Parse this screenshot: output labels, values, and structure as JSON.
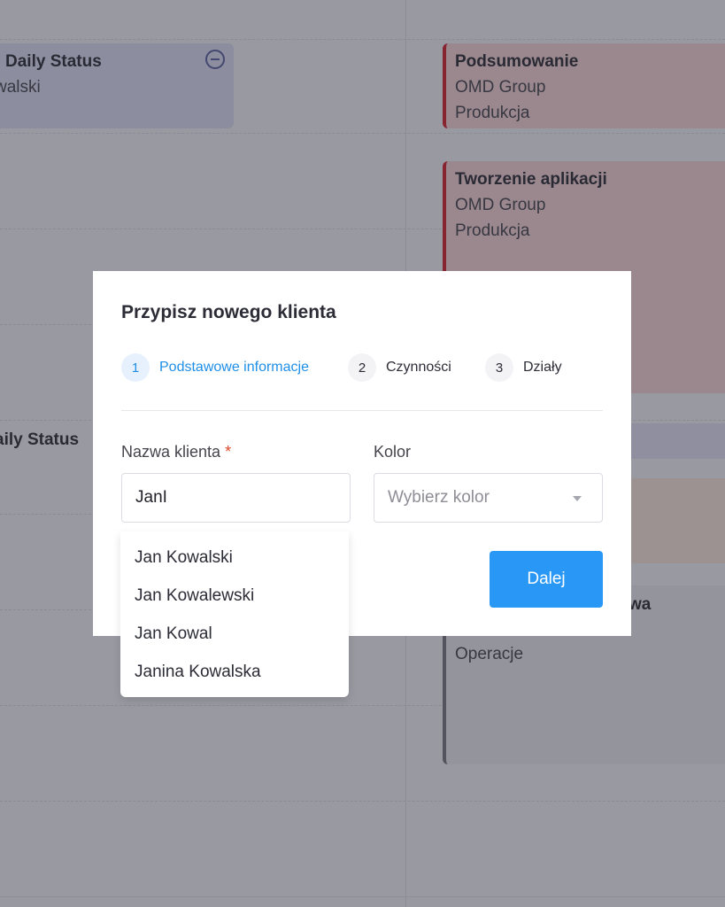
{
  "calendar": {
    "events": {
      "daily_status_1": {
        "title": "Daily Status",
        "subtitle": "walski"
      },
      "podsumowanie": {
        "title": "Podsumowanie",
        "client": "OMD Group",
        "department": "Produkcja"
      },
      "tworzenie": {
        "title": "Tworzenie aplikacji",
        "client": "OMD Group",
        "department": "Produkcja"
      },
      "daily_status_2": {
        "title": "aily Status"
      },
      "grey_event": {
        "title_fragment": "wa",
        "department": "Operacje"
      }
    }
  },
  "modal": {
    "title": "Przypisz nowego klienta",
    "steps": [
      {
        "number": "1",
        "label": "Podstawowe informacje",
        "active": true
      },
      {
        "number": "2",
        "label": "Czynności",
        "active": false
      },
      {
        "number": "3",
        "label": "Działy",
        "active": false
      }
    ],
    "fields": {
      "client_name": {
        "label": "Nazwa klienta",
        "required_mark": "*",
        "value": "JanI"
      },
      "color": {
        "label": "Kolor",
        "placeholder": "Wybierz kolor"
      }
    },
    "next_button": "Dalej"
  },
  "autocomplete": {
    "options": [
      "Jan Kowalski",
      "Jan Kowalewski",
      "Jan Kowal",
      "Janina Kowalska"
    ]
  },
  "colors": {
    "accent": "#2997f5",
    "active_step": "#1f8fe6",
    "required": "#e0452a",
    "event_red_border": "#d61f2b",
    "event_red_bg": "#f6d5d5",
    "event_lavender_bg": "#dde0f4"
  }
}
